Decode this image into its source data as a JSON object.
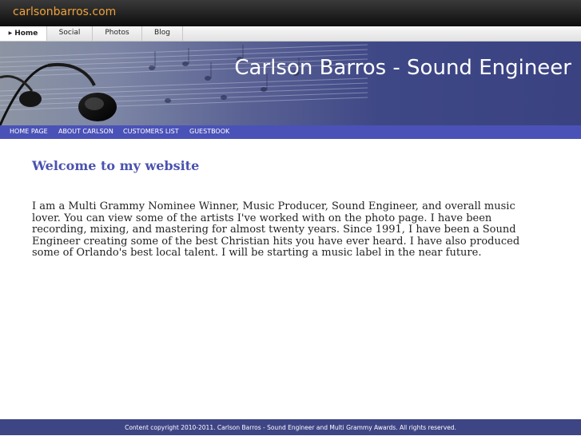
{
  "site": {
    "name": "carlsonbarros.com"
  },
  "tabs": [
    {
      "label": "Home",
      "active": true
    },
    {
      "label": "Social",
      "active": false
    },
    {
      "label": "Photos",
      "active": false
    },
    {
      "label": "Blog",
      "active": false
    }
  ],
  "banner": {
    "title": "Carlson Barros - Sound Engineer"
  },
  "nav": {
    "items": [
      {
        "label": "HOME PAGE"
      },
      {
        "label": "ABOUT CARLSON"
      },
      {
        "label": "CUSTOMERS LIST"
      },
      {
        "label": "GUESTBOOK"
      }
    ]
  },
  "main": {
    "heading": "Welcome to my website",
    "body": "I am a Multi Grammy Nominee Winner, Music Producer, Sound Engineer, and overall music lover.  You can view some of the artists I've worked with on the photo page. I have been recording, mixing, and mastering for almost twenty years. Since 1991, I have been a Sound Engineer creating some of the best Christian hits you have ever heard. I have also produced some of Orlando's best local talent. I will be starting a music label in the near future."
  },
  "footer": {
    "text": "Content copyright 2010-2011. Carlson Barros - Sound Engineer and Multi Grammy Awards. All rights reserved."
  },
  "colors": {
    "accent": "#4a52b8",
    "site_name": "#f0a23a",
    "heading": "#4a52b0",
    "footer": "#3e4585"
  },
  "icons": {
    "banner_art": "headphones-sheet-music-image",
    "tab_marker": "triangle-right-icon"
  }
}
